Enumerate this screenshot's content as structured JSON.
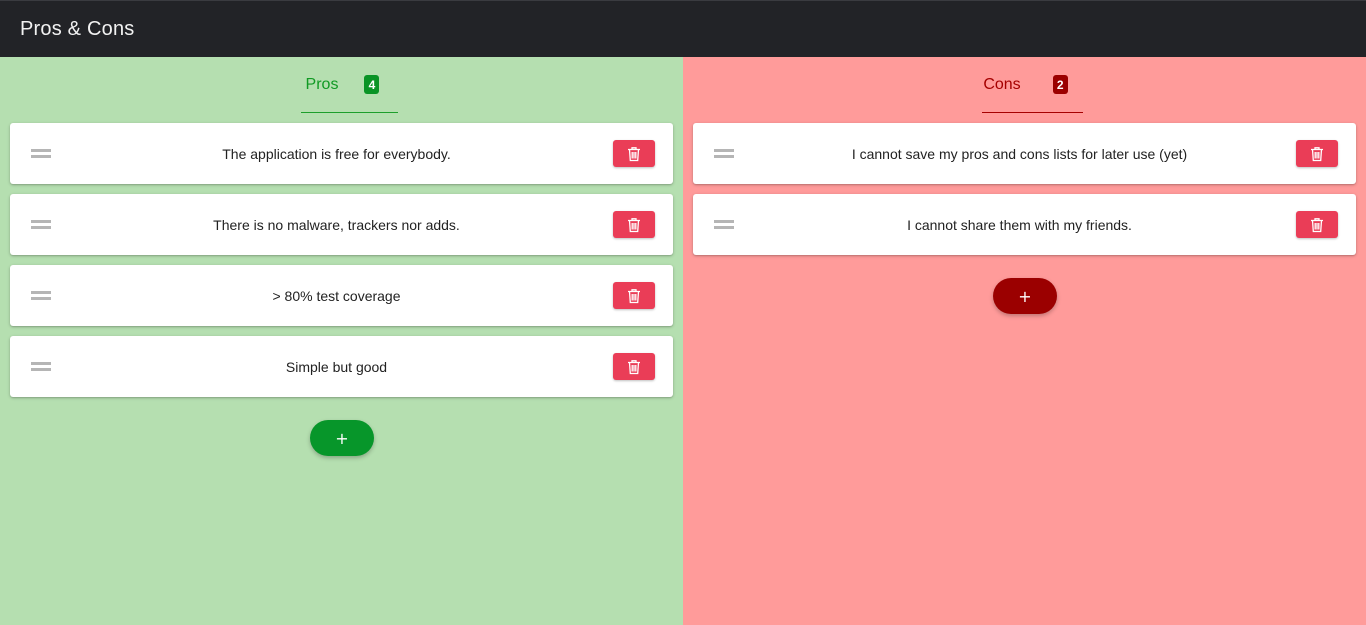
{
  "app": {
    "title": "Pros & Cons"
  },
  "colors": {
    "pros_accent": "#0a9426",
    "pros_background": "#b5dfb0",
    "cons_accent": "#9b0000",
    "cons_background": "#ff9b9a",
    "delete_button": "#ea3d57",
    "appbar": "#222327"
  },
  "pros": {
    "label": "Pros",
    "count": "4",
    "items": [
      {
        "text": "The application is free for everybody."
      },
      {
        "text": "There is no malware, trackers nor adds."
      },
      {
        "text": "> 80% test coverage"
      },
      {
        "text": "Simple but good"
      }
    ],
    "add_label": "+"
  },
  "cons": {
    "label": "Cons",
    "count": "2",
    "items": [
      {
        "text": "I cannot save my pros and cons lists for later use (yet)"
      },
      {
        "text": "I cannot share them with my friends."
      }
    ],
    "add_label": "+"
  },
  "icons": {
    "drag": "drag-handle-icon",
    "delete": "trash-icon"
  }
}
